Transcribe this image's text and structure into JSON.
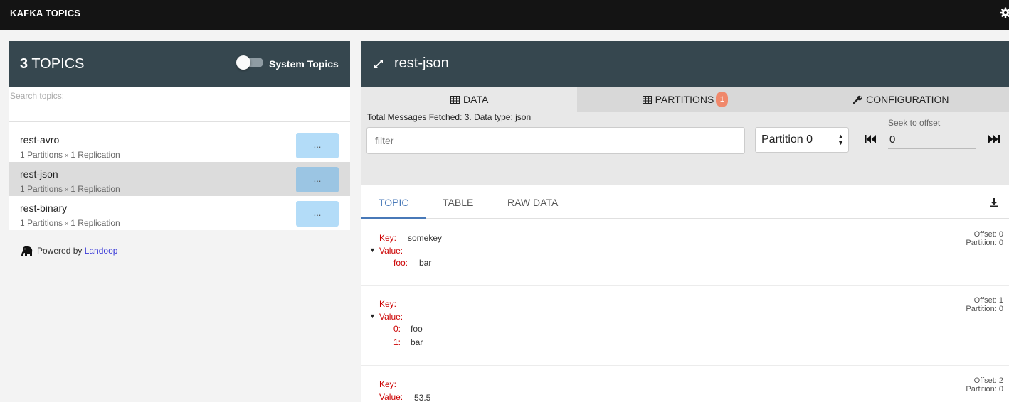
{
  "app": {
    "title": "KAFKA TOPICS",
    "settings_icon": "gear-icon"
  },
  "sidebar": {
    "topic_count": "3",
    "topic_count_label": " TOPICS",
    "system_topics_label": "System Topics",
    "search_label": "Search topics:",
    "search_value": "",
    "topics": [
      {
        "name": "rest-avro",
        "partitions": "1 Partitions",
        "replication": "1 Replication",
        "button": "..."
      },
      {
        "name": "rest-json",
        "partitions": "1 Partitions",
        "replication": "1 Replication",
        "button": "..."
      },
      {
        "name": "rest-binary",
        "partitions": "1 Partitions",
        "replication": "1 Replication",
        "button": "..."
      }
    ],
    "powered_by": "Powered by ",
    "powered_by_link": "Landoop"
  },
  "topic_view": {
    "title": "rest-json",
    "tabs": {
      "data": "DATA",
      "partitions": "PARTITIONS",
      "partitions_badge": "1",
      "configuration": "CONFIGURATION"
    },
    "fetched_info": "Total Messages Fetched: 3. Data type: json",
    "filter_placeholder": "filter",
    "partition_select": "Partition 0",
    "seek_label": "Seek to offset",
    "seek_value": "0",
    "sub_tabs": {
      "topic": "TOPIC",
      "table": "TABLE",
      "raw": "RAW DATA"
    },
    "messages": [
      {
        "key_label": "Key:",
        "key": "somekey",
        "value_label": "Value:",
        "field_key": "foo:",
        "field_value": "bar",
        "offset": "Offset: 0",
        "partition": "Partition: 0"
      },
      {
        "key_label": "Key:",
        "value_label": "Value:",
        "items": [
          {
            "idx": "0:",
            "val": "foo"
          },
          {
            "idx": "1:",
            "val": "bar"
          }
        ],
        "offset": "Offset: 1",
        "partition": "Partition: 0"
      },
      {
        "key_label": "Key:",
        "value_label": "Value:",
        "value": "53.5",
        "offset": "Offset: 2",
        "partition": "Partition: 0"
      }
    ]
  }
}
